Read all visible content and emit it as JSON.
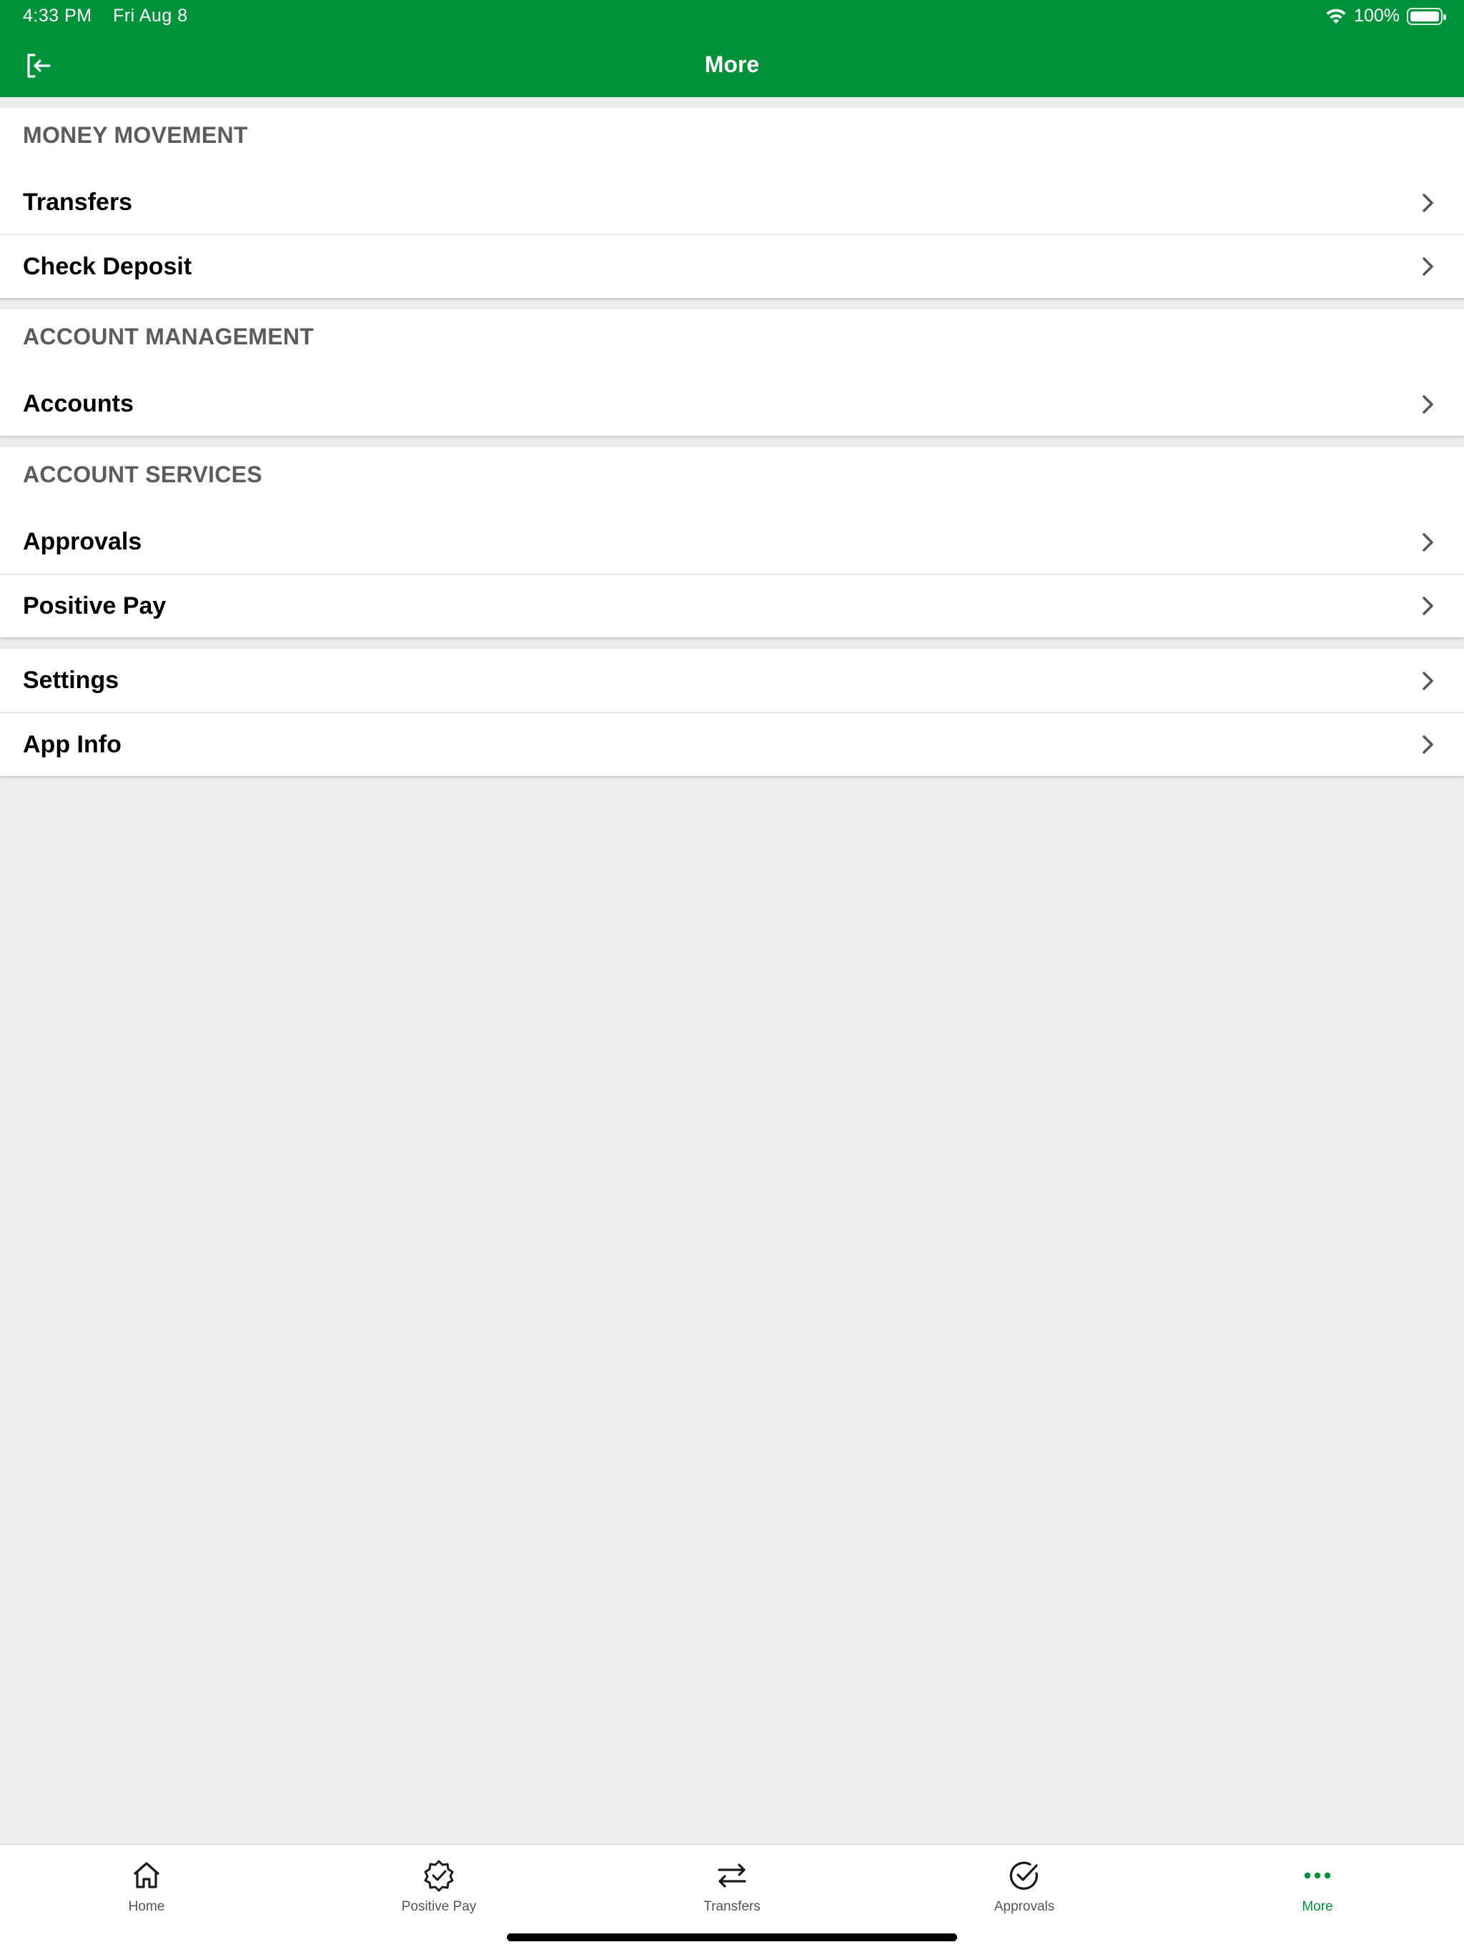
{
  "status_bar": {
    "time": "4:33 PM",
    "date": "Fri Aug 8",
    "battery": "100%"
  },
  "header": {
    "title": "More",
    "logout_icon": "logout-icon"
  },
  "sections": {
    "money_movement": {
      "title": "MONEY MOVEMENT",
      "items": [
        {
          "label": "Transfers"
        },
        {
          "label": "Check Deposit"
        }
      ]
    },
    "account_management": {
      "title": "ACCOUNT MANAGEMENT",
      "items": [
        {
          "label": "Accounts"
        }
      ]
    },
    "account_services": {
      "title": "ACCOUNT SERVICES",
      "items": [
        {
          "label": "Approvals"
        },
        {
          "label": "Positive Pay"
        }
      ]
    },
    "misc": {
      "items": [
        {
          "label": "Settings"
        },
        {
          "label": "App Info"
        }
      ]
    }
  },
  "tabbar": {
    "tabs": [
      {
        "label": "Home",
        "icon": "home-icon"
      },
      {
        "label": "Positive Pay",
        "icon": "badge-check-icon"
      },
      {
        "label": "Transfers",
        "icon": "swap-arrows-icon"
      },
      {
        "label": "Approvals",
        "icon": "circle-check-icon"
      },
      {
        "label": "More",
        "icon": "more-dots-icon",
        "active": true
      }
    ]
  },
  "colors": {
    "brand_green": "#00913a",
    "background": "#ededed"
  }
}
